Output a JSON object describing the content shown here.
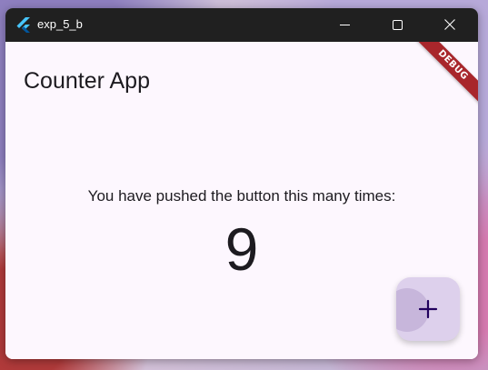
{
  "window": {
    "title": "exp_5_b",
    "app_icon": "flutter-logo-icon",
    "controls": {
      "minimize_icon": "minimize-icon",
      "maximize_icon": "maximize-icon",
      "close_icon": "close-icon"
    }
  },
  "appbar": {
    "title": "Counter App"
  },
  "body": {
    "message": "You have pushed the button this many times:",
    "counter": "9"
  },
  "fab": {
    "icon": "plus-icon"
  },
  "debug_banner": {
    "label": "DEBUG"
  },
  "colors": {
    "titlebar": "#202020",
    "background": "#fdf7fe",
    "fab": "#ddd0ec",
    "fab_icon": "#21005d",
    "debug_banner": "#a8262b"
  }
}
